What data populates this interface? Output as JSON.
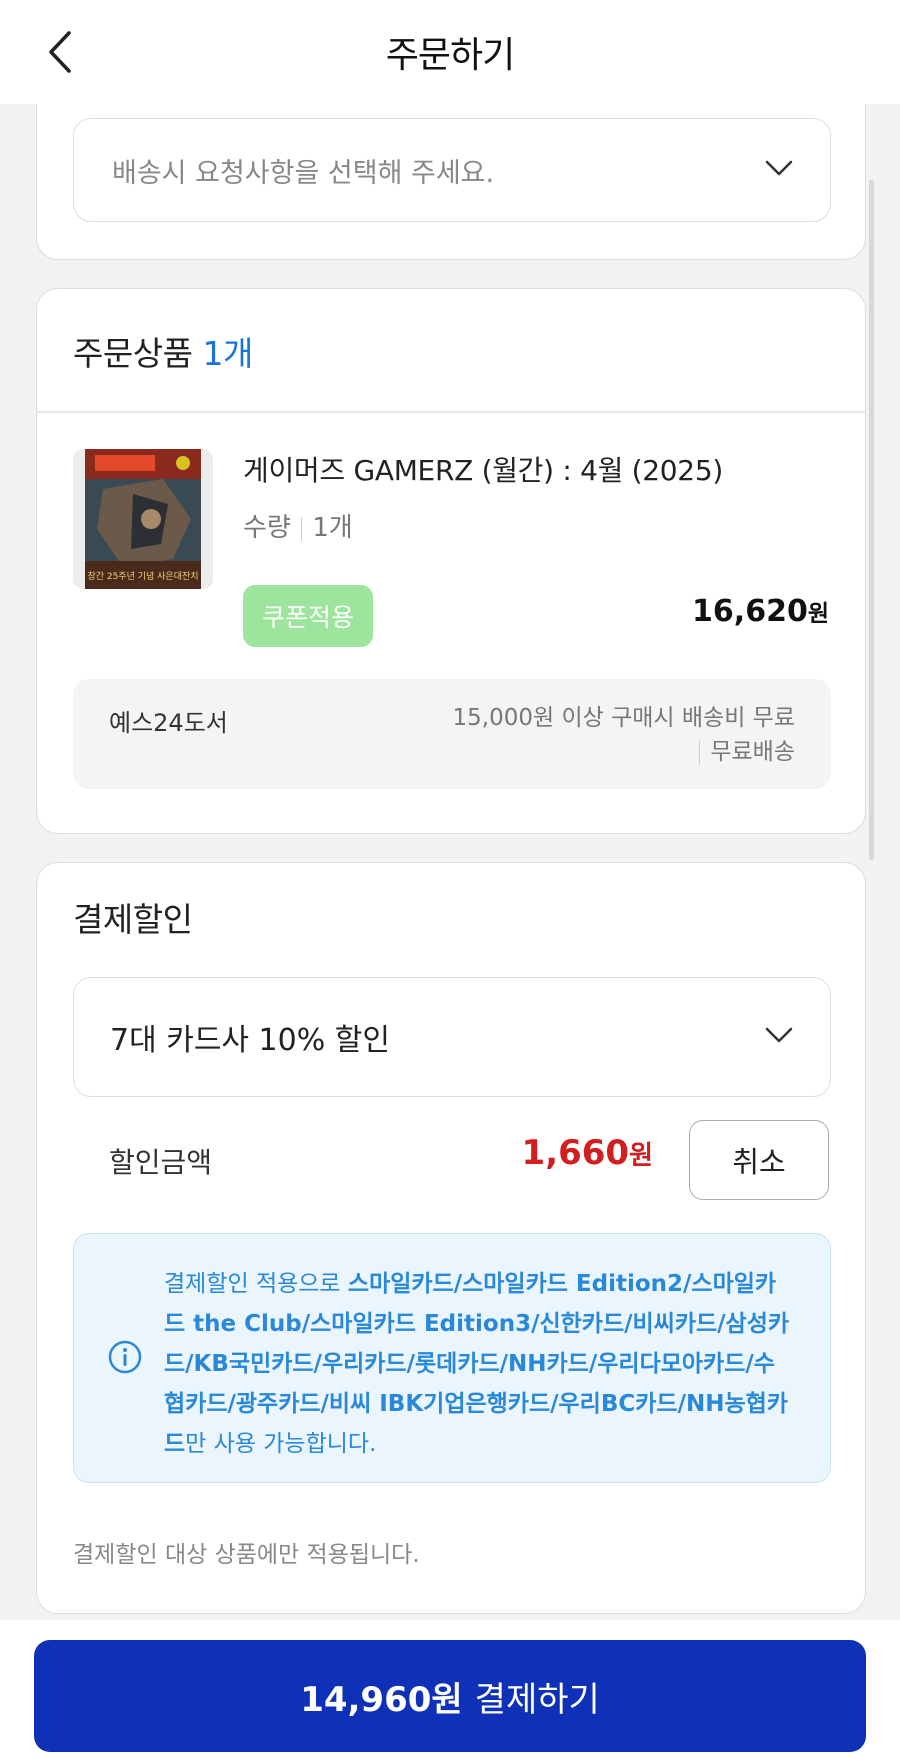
{
  "header": {
    "title": "주문하기"
  },
  "delivery": {
    "request_placeholder": "배송시 요청사항을 선택해 주세요."
  },
  "order_items": {
    "title": "주문상품",
    "count": "1개",
    "product": {
      "name": "게이머즈 GAMERZ (월간) : 4월 (2025)",
      "qty_label": "수량",
      "qty_value": "1개",
      "coupon_label": "쿠폰적용",
      "price": "16,620",
      "price_unit": "원",
      "cover_caption": "창간 25주년 기념 사은대잔치"
    },
    "shipping": {
      "seller": "예스24도서",
      "condition": "15,000원 이상 구매시 배송비 무료",
      "type": "무료배송"
    }
  },
  "payment_discount": {
    "title": "결제할인",
    "selected_option": "7대 카드사 10% 할인",
    "discount_label": "할인금액",
    "discount_amount": "1,660",
    "discount_unit": "원",
    "cancel_label": "취소",
    "notice_prefix": "결제할인 적용으로 ",
    "notice_cards": "스마일카드/스마일카드 Edition2/스마일카드 the Club/스마일카드 Edition3/신한카드/비씨카드/삼성카드/KB국민카드/우리카드/롯데카드/NH카드/우리다모아카드/수협카드/광주카드/비씨 IBK기업은행카드/우리BC카드/NH농협카드",
    "notice_suffix": "만 사용 가능합니다.",
    "footnote": "결제할인 대상 상품에만 적용됩니다."
  },
  "checkout": {
    "amount": "14,960원",
    "label": "결제하기"
  },
  "colors": {
    "accent_blue": "#1a73d9",
    "pay_button": "#0f31b8",
    "discount_red": "#d21e1e",
    "coupon_green": "#9de49d"
  },
  "icons": [
    "back-arrow-icon",
    "chevron-down-icon",
    "info-icon"
  ]
}
